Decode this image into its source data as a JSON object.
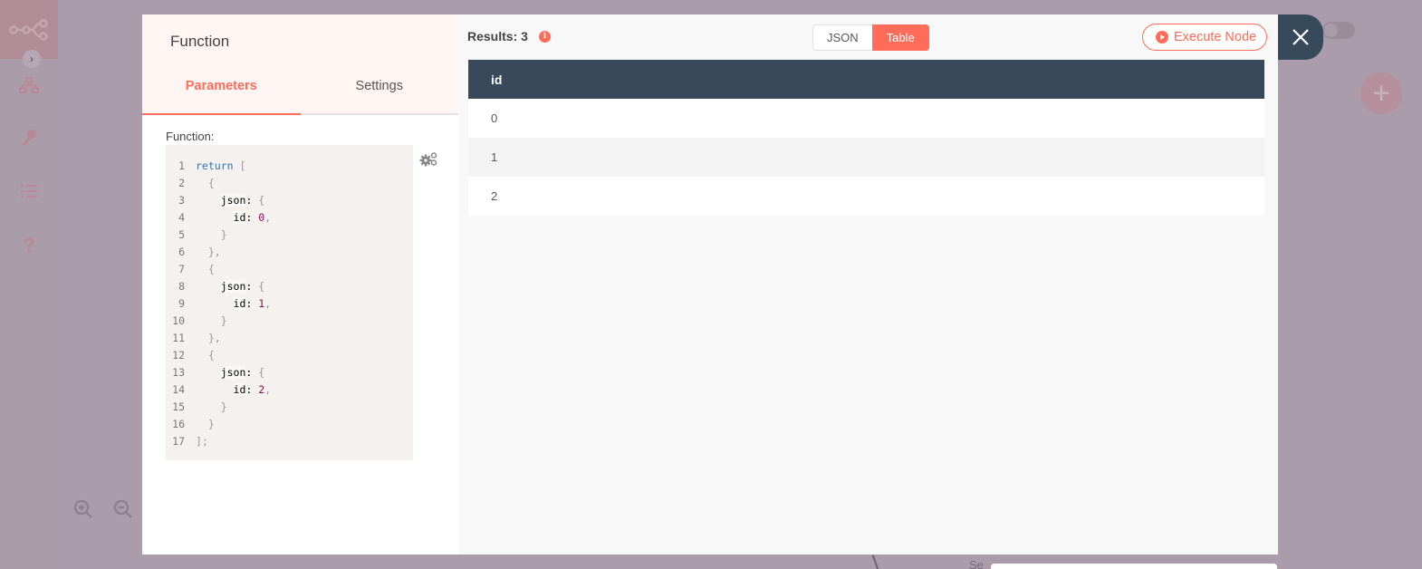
{
  "background": {
    "sidebar_icons": [
      "workflow-icon",
      "credentials-key-icon",
      "executions-list-icon",
      "help-icon"
    ],
    "zoom_controls": [
      "zoom-in-icon",
      "zoom-out-icon"
    ],
    "canvas_node_partial_label": "Se"
  },
  "node_panel": {
    "title": "Function",
    "tabs": [
      {
        "label": "Parameters",
        "active": true
      },
      {
        "label": "Settings",
        "active": false
      }
    ],
    "field_label": "Function:",
    "code_lines": [
      "return [",
      "  {",
      "    json: {",
      "      id: 0,",
      "    }",
      "  },",
      "  {",
      "    json: {",
      "      id: 1,",
      "    }",
      "  },",
      "  {",
      "    json: {",
      "      id: 2,",
      "    }",
      "  }",
      "];"
    ]
  },
  "output_panel": {
    "results_label": "Results: 3",
    "view_modes": [
      {
        "label": "JSON",
        "active": false
      },
      {
        "label": "Table",
        "active": true
      }
    ],
    "execute_label": "Execute Node",
    "table": {
      "columns": [
        "id"
      ],
      "rows": [
        [
          "0"
        ],
        [
          "1"
        ],
        [
          "2"
        ]
      ]
    }
  },
  "colors": {
    "accent": "#ff6d5a",
    "header_dark": "#37495a"
  }
}
